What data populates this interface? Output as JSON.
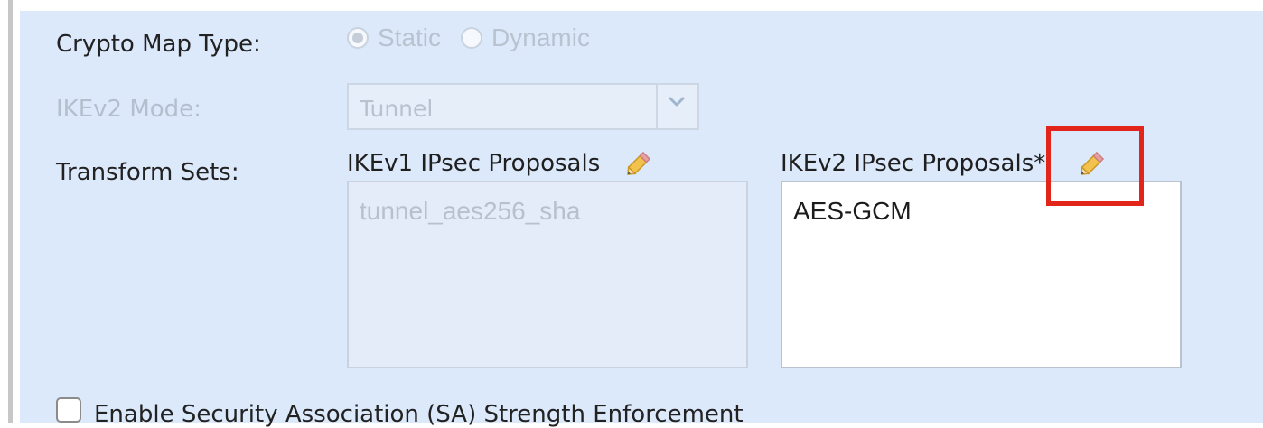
{
  "crypto_map_type": {
    "label": "Crypto Map Type:",
    "options": [
      {
        "label": "Static",
        "selected": true
      },
      {
        "label": "Dynamic",
        "selected": false
      }
    ],
    "enabled": false
  },
  "ikev2_mode": {
    "label": "IKEv2 Mode:",
    "value": "Tunnel",
    "enabled": false
  },
  "transform_sets": {
    "label": "Transform Sets:",
    "ikev1": {
      "header": "IKEv1 IPsec Proposals",
      "items": [
        "tunnel_aes256_sha"
      ],
      "enabled": false
    },
    "ikev2": {
      "header": "IKEv2 IPsec Proposals*",
      "items": [
        "AES-GCM"
      ],
      "enabled": true
    }
  },
  "sa_strength": {
    "label": "Enable Security Association (SA) Strength Enforcement",
    "checked": false
  },
  "icons": {
    "edit": "pencil-icon",
    "dropdown": "chevron-down-icon"
  },
  "colors": {
    "panel_background": "#dce9fb",
    "highlight": "#e1251b"
  }
}
